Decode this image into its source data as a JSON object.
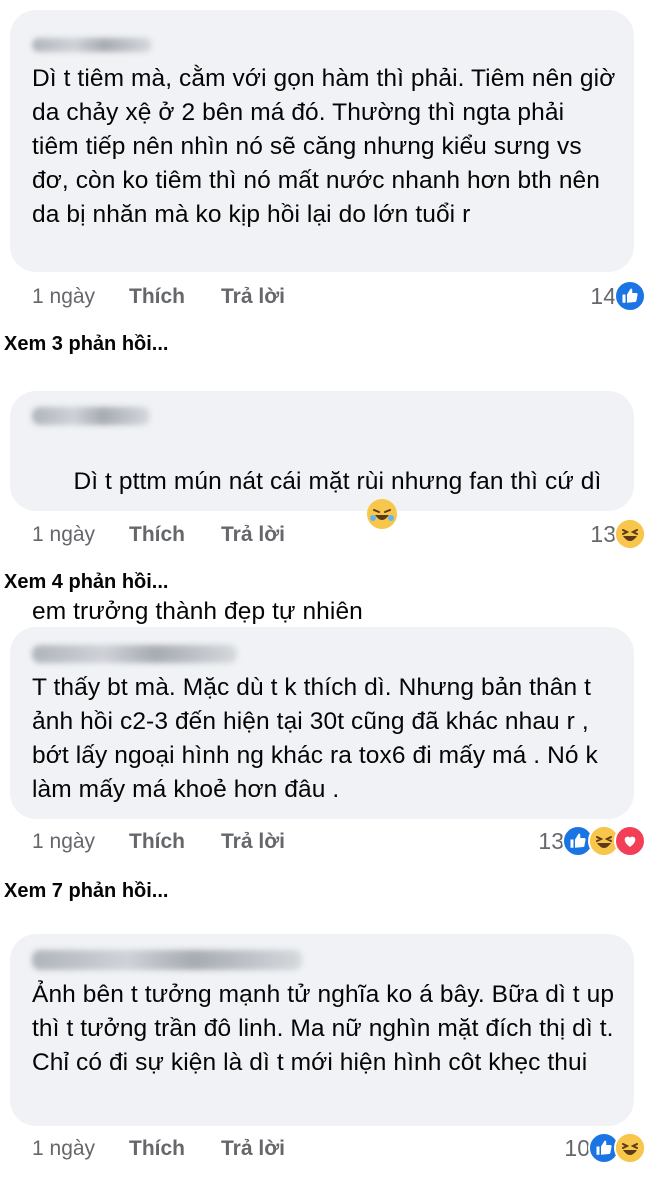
{
  "comments": [
    {
      "text": "Dì t tiêm mà, cằm với gọn hàm thì phải. Tiêm nên giờ da chảy xệ ở 2 bên má đó. Thường thì ngta phải tiêm tiếp nên nhìn nó sẽ căng nhưng kiểu sưng vs đơ, còn ko tiêm thì nó mất nước nhanh hơn bth nên da bị nhăn mà ko kịp hồi lại do lớn tuổi r",
      "time": "1 ngày",
      "like_label": "Thích",
      "reply_label": "Trả lời",
      "reaction_count": "14",
      "reactions": [
        "like-icon"
      ],
      "view_replies": "Xem 3 phản hồi..."
    },
    {
      "text": "Dì t pttm mún nát cái mặt rùi nhưng fan thì cứ dì em trưởng thành đẹp tự nhiên",
      "inline_emoji": "rolling-laughing-emoji-icon",
      "time": "1 ngày",
      "like_label": "Thích",
      "reply_label": "Trả lời",
      "reaction_count": "13",
      "reactions": [
        "haha-icon"
      ],
      "view_replies": "Xem 4 phản hồi..."
    },
    {
      "text": "T thấy bt mà. Mặc dù t k thích dì. Nhưng bản thân t ảnh hồi c2-3 đến hiện tại 30t cũng đã khác nhau r , bớt lấy ngoại hình ng khác ra tox6 đi mấy má . Nó k làm mấy má khoẻ hơn đâu .",
      "time": "1 ngày",
      "like_label": "Thích",
      "reply_label": "Trả lời",
      "reaction_count": "13",
      "reactions": [
        "like-icon",
        "haha-icon",
        "love-icon"
      ],
      "view_replies": "Xem 7 phản hồi..."
    },
    {
      "text": "Ảnh bên t tưởng mạnh tử nghĩa ko á bây. Bữa dì t up thì t tưởng trần đô linh. Ma nữ nghìn mặt đích thị dì t.  Chỉ có đi sự kiện là dì t mới hiện hình côt khẹc thui",
      "time": "1 ngày",
      "like_label": "Thích",
      "reply_label": "Trả lời",
      "reaction_count": "10",
      "reactions": [
        "like-icon",
        "haha-icon"
      ]
    }
  ],
  "colors": {
    "bubble": "#f0f2f5",
    "meta_text": "#65676b",
    "like_blue": "#1b74e4",
    "haha_yellow": "#f7c64b",
    "love_red": "#f33e58"
  }
}
